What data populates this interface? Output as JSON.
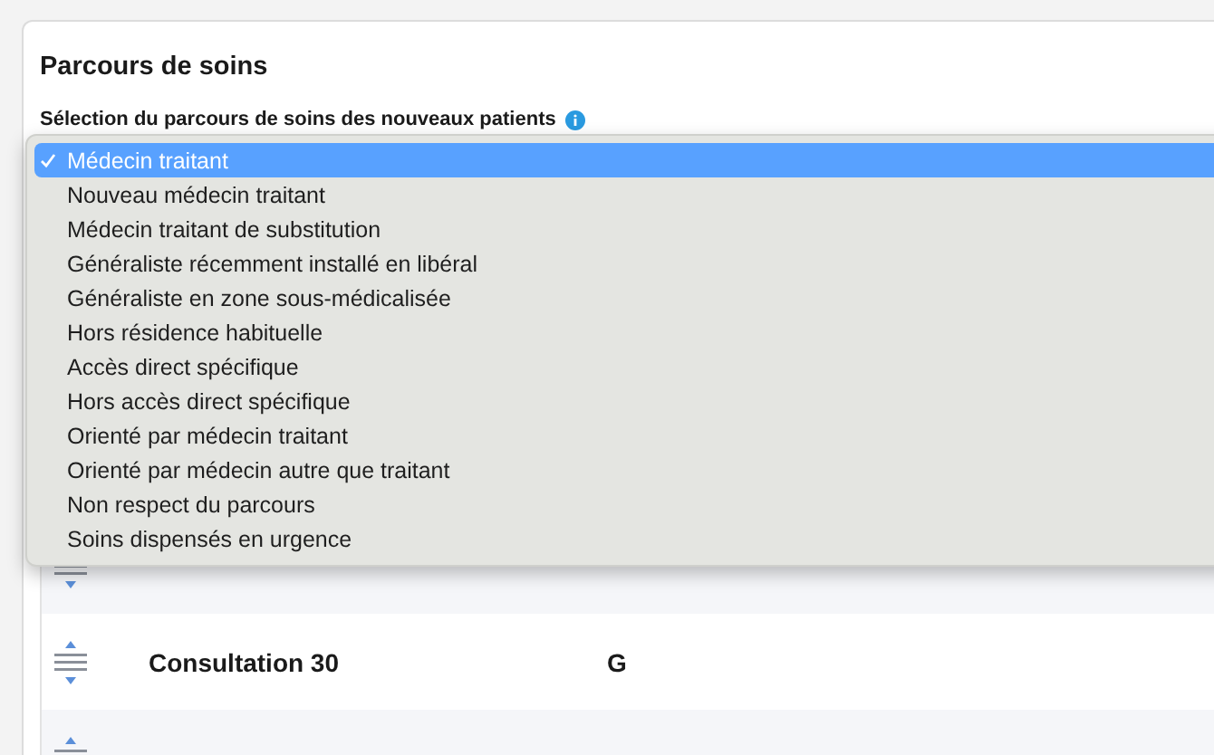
{
  "card": {
    "title": "Parcours de soins",
    "field_label": "Sélection du parcours de soins des nouveaux patients"
  },
  "dropdown": {
    "options": [
      {
        "label": "Médecin traitant",
        "selected": true
      },
      {
        "label": "Nouveau médecin traitant",
        "selected": false
      },
      {
        "label": "Médecin traitant de substitution",
        "selected": false
      },
      {
        "label": "Généraliste récemment installé en libéral",
        "selected": false
      },
      {
        "label": "Généraliste en zone sous-médicalisée",
        "selected": false
      },
      {
        "label": "Hors résidence habituelle",
        "selected": false
      },
      {
        "label": "Accès direct spécifique",
        "selected": false
      },
      {
        "label": "Hors accès direct spécifique",
        "selected": false
      },
      {
        "label": "Orienté par médecin traitant",
        "selected": false
      },
      {
        "label": "Orienté par médecin autre que traitant",
        "selected": false
      },
      {
        "label": "Non respect du parcours",
        "selected": false
      },
      {
        "label": "Soins dispensés en urgence",
        "selected": false
      }
    ]
  },
  "table": {
    "rows": [
      {
        "kind": "covered"
      },
      {
        "kind": "full",
        "name": "Consultation 30",
        "column_2": "G"
      },
      {
        "kind": "covered"
      }
    ]
  }
}
